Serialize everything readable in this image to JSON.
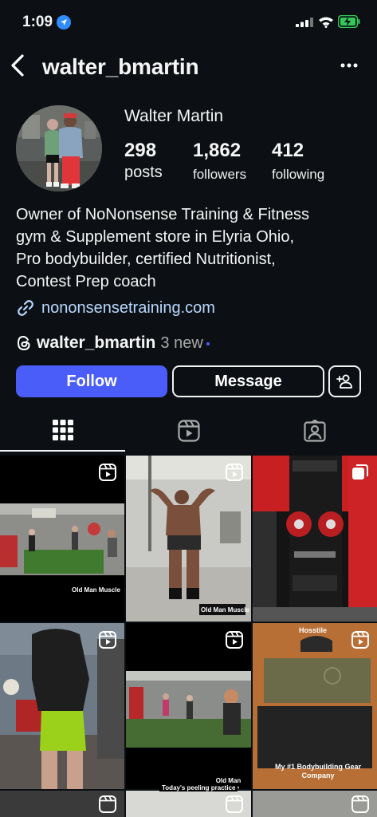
{
  "status_bar": {
    "time": "1:09"
  },
  "header": {
    "username": "walter_bmartin"
  },
  "profile": {
    "display_name": "Walter Martin",
    "stats": {
      "posts": {
        "value": "298",
        "label": "posts"
      },
      "followers": {
        "value": "1,862",
        "label": "followers"
      },
      "following": {
        "value": "412",
        "label": "following"
      }
    },
    "bio": "Owner of NoNonsense Training & Fitness\ngym & Supplement store in Elyria Ohio,\nPro bodybuilder, certified Nutritionist,\nContest Prep coach",
    "link": "nononsensetraining.com",
    "threads": {
      "handle": "walter_bmartin",
      "badge": "3 new"
    }
  },
  "actions": {
    "follow": "Follow",
    "message": "Message"
  },
  "tabs": [
    {
      "icon": "grid-icon",
      "active": true
    },
    {
      "icon": "reels-icon",
      "active": false
    },
    {
      "icon": "tagged-icon",
      "active": false
    }
  ],
  "posts": [
    {
      "type": "reel",
      "caption": "Old Man Muscle"
    },
    {
      "type": "reel",
      "caption": "Old Man Muscle"
    },
    {
      "type": "carousel",
      "caption": ""
    },
    {
      "type": "reel",
      "caption": ""
    },
    {
      "type": "reel",
      "caption": "Old Man Muscle",
      "top_caption": "Today's peeling practice"
    },
    {
      "type": "reel",
      "caption": "My #1 Bodybuilding Gear\nCompany",
      "top_caption": "Hosstile"
    }
  ],
  "colors": {
    "background": "#0c1014",
    "accent": "#4a5df9",
    "link": "#b8d8ff",
    "location": "#2f8cff",
    "battery": "#34c759"
  }
}
